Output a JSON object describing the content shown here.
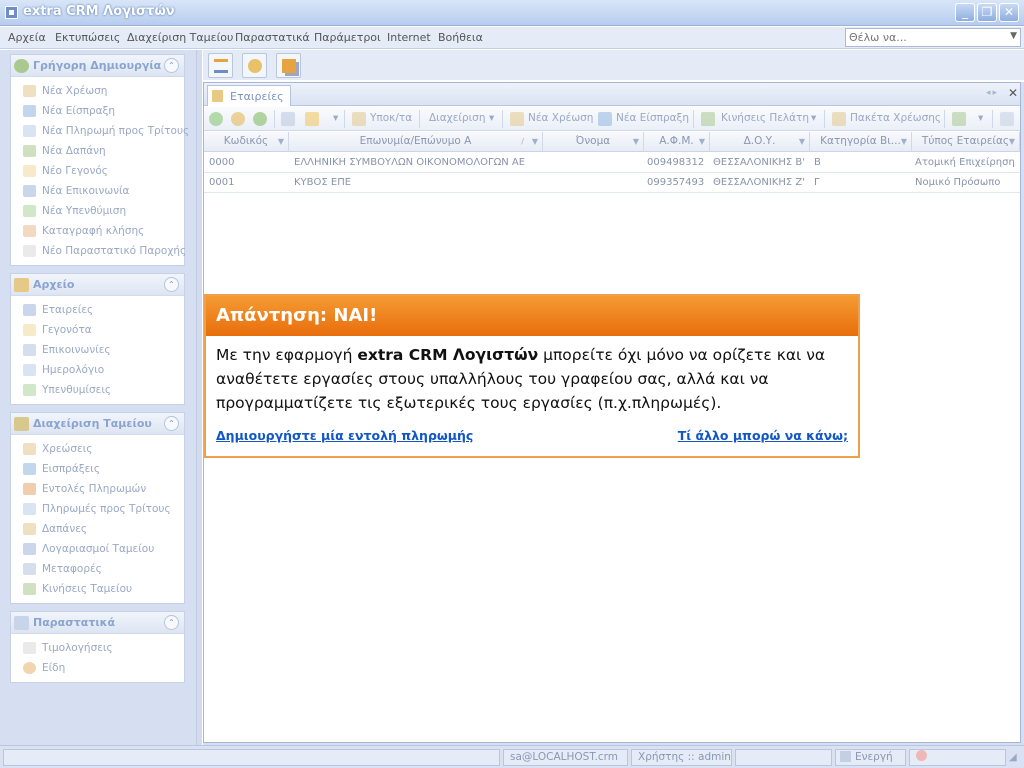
{
  "window": {
    "title": "extra CRM Λογιστών"
  },
  "menu": {
    "items": [
      "Αρχεία",
      "Εκτυπώσεις",
      "Διαχείριση Ταμείου",
      "Παραστατικά",
      "Παράμετροι",
      "Internet",
      "Βοήθεια"
    ],
    "search_placeholder": "Θέλω να..."
  },
  "left": {
    "quick": {
      "title": "Γρήγορη Δημιουργία",
      "items": [
        "Νέα Χρέωση",
        "Νέα Είσπραξη",
        "Νέα Πληρωμή προς Τρίτους",
        "Νέα Δαπάνη",
        "Νέο Γεγονός",
        "Νέα Επικοινωνία",
        "Νέα Υπενθύμιση",
        "Καταγραφή κλήσης",
        "Νέο Παραστατικό Παροχής"
      ]
    },
    "archive": {
      "title": "Αρχείο",
      "items": [
        "Εταιρείες",
        "Γεγονότα",
        "Επικοινωνίες",
        "Ημερολόγιο",
        "Υπενθυμίσεις"
      ]
    },
    "cash": {
      "title": "Διαχείριση Ταμείου",
      "items": [
        "Χρεώσεις",
        "Εισπράξεις",
        "Εντολές Πληρωμών",
        "Πληρωμές προς Τρίτους",
        "Δαπάνες",
        "Λογαριασμοί Ταμείου",
        "Μεταφορές",
        "Κινήσεις Ταμείου"
      ]
    },
    "docs": {
      "title": "Παραστατικά",
      "items": [
        "Τιμολογήσεις",
        "Είδη"
      ]
    }
  },
  "tab": {
    "label": "Εταιρείες"
  },
  "gridtools": {
    "prospect": "Υποκ/τα",
    "manage": "Διαχείριση",
    "new_charge": "Νέα Χρέωση",
    "new_receipt": "Νέα Είσπραξη",
    "client_moves": "Κινήσεις Πελάτη",
    "charge_packages": "Πακέτα Χρέωσης"
  },
  "grid": {
    "columns": [
      "Κωδικός",
      "Επωνυμία/Επώνυμο Α",
      "Όνομα",
      "Α.Φ.Μ.",
      "Δ.Ο.Υ.",
      "Κατηγορία Βι...",
      "Τύπος Εταιρείας"
    ],
    "rows": [
      [
        "0000",
        "ΕΛΛΗΝΙΚΗ ΣΥΜΒΟΥΛΩΝ ΟΙΚΟΝΟΜΟΛΟΓΩΝ ΑΕ",
        "",
        "009498312",
        "ΘΕΣΣΑΛΟΝΙΚΗΣ Β'",
        "Β",
        "Ατομική Επιχείρηση"
      ],
      [
        "0001",
        "ΚΥΒΟΣ ΕΠΕ",
        "",
        "099357493",
        "ΘΕΣΣΑΛΟΝΙΚΗΣ Ζ'",
        "Γ",
        "Νομικό Πρόσωπο"
      ]
    ]
  },
  "popup": {
    "title": "Απάντηση: ΝΑΙ!",
    "text_before": "Με την εφαρμογή ",
    "text_bold": "extra CRM Λογιστών",
    "text_after": " μπορείτε όχι μόνο να ορίζετε και να αναθέτετε εργασίες στους υπαλλήλους του γραφείου σας, αλλά και να προγραμματίζετε τις εξωτερικές τους εργασίες (π.χ.πληρωμές).",
    "link_left": "Δημιουργήστε μία εντολή πληρωμής",
    "link_right": "Τί άλλο μπορώ να κάνω;"
  },
  "status": {
    "server": "sa@LOCALHOST.crm",
    "user": "Χρήστης :: admin",
    "state": "Ενεργή"
  }
}
